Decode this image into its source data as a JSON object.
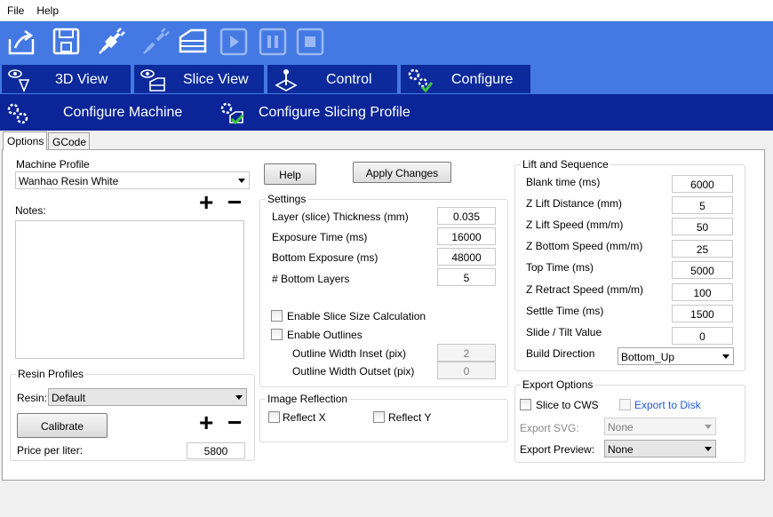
{
  "menu": {
    "file": "File",
    "help": "Help"
  },
  "main_tabs": {
    "view3d": "3D View",
    "slice_view": "Slice View",
    "control": "Control",
    "configure": "Configure"
  },
  "sub_tabs": {
    "configure_machine": "Configure Machine",
    "configure_slicing": "Configure Slicing Profile"
  },
  "inner_tabs": {
    "options": "Options",
    "gcode": "GCode"
  },
  "machine": {
    "title": "Machine Profile",
    "profile": "Wanhao Resin White",
    "notes_label": "Notes:",
    "plus": "+",
    "minus": "−"
  },
  "resin": {
    "title": "Resin Profiles",
    "resin_label": "Resin:",
    "resin_value": "Default",
    "calibrate": "Calibrate",
    "price_label": "Price per liter:",
    "price_value": "5800",
    "plus": "+",
    "minus": "−"
  },
  "actions": {
    "help": "Help",
    "apply": "Apply Changes"
  },
  "settings": {
    "title": "Settings",
    "layer_label": "Layer (slice) Thickness (mm)",
    "layer_value": "0.035",
    "exposure_label": "Exposure Time (ms)",
    "exposure_value": "16000",
    "bottom_exposure_label": "Bottom Exposure (ms)",
    "bottom_exposure_value": "48000",
    "bottom_layers_label": "# Bottom Layers",
    "bottom_layers_value": "5",
    "enable_slice_size": "Enable Slice Size Calculation",
    "enable_outlines": "Enable Outlines",
    "outline_inset_label": "Outline Width Inset (pix)",
    "outline_inset_value": "2",
    "outline_outset_label": "Outline Width Outset (pix)",
    "outline_outset_value": "0"
  },
  "reflection": {
    "title": "Image Reflection",
    "reflect_x": "Reflect X",
    "reflect_y": "Reflect Y"
  },
  "lift": {
    "title": "Lift and Sequence",
    "blank_label": "Blank time (ms)",
    "blank_value": "6000",
    "z_lift_label": "Z Lift Distance (mm)",
    "z_lift_value": "5",
    "z_lift_speed_label": "Z Lift Speed (mm/m)",
    "z_lift_speed_value": "50",
    "z_bottom_speed_label": "Z Bottom Speed (mm/m)",
    "z_bottom_speed_value": "25",
    "top_time_label": "Top Time (ms)",
    "top_time_value": "5000",
    "z_retract_label": "Z Retract Speed (mm/m)",
    "z_retract_value": "100",
    "settle_label": "Settle Time (ms)",
    "settle_value": "1500",
    "slide_label": "Slide / Tilt Value",
    "slide_value": "0",
    "build_dir_label": "Build Direction",
    "build_dir_value": "Bottom_Up"
  },
  "export": {
    "title": "Export Options",
    "slice_cws": "Slice to CWS",
    "export_disk": "Export to Disk",
    "svg_label": "Export SVG:",
    "svg_value": "None",
    "preview_label": "Export Preview:",
    "preview_value": "None"
  },
  "colors": {
    "toolbar_bg": "#4479e3",
    "tab_bg": "#0c2a9c",
    "sub_bg": "#0b2497",
    "link_blue": "#1f5bd6"
  }
}
